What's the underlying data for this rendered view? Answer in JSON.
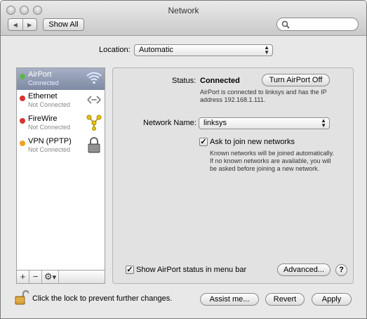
{
  "window": {
    "title": "Network"
  },
  "toolbar": {
    "back": "◀",
    "forward": "▶",
    "show_all": "Show All",
    "search_placeholder": ""
  },
  "location": {
    "label": "Location:",
    "value": "Automatic"
  },
  "services": [
    {
      "name": "AirPort",
      "status": "Connected",
      "dot": "#5ab64c",
      "icon": "wifi-icon"
    },
    {
      "name": "Ethernet",
      "status": "Not Connected",
      "dot": "#d8332c",
      "icon": "ethernet-icon"
    },
    {
      "name": "FireWire",
      "status": "Not Connected",
      "dot": "#d8332c",
      "icon": "firewire-icon"
    },
    {
      "name": "VPN (PPTP)",
      "status": "Not Connected",
      "dot": "#f0a21e",
      "icon": "vpn-lock-icon"
    }
  ],
  "sidebar_controls": {
    "add": "+",
    "remove": "−",
    "action": "⚙"
  },
  "detail": {
    "status_label": "Status:",
    "status_value": "Connected",
    "turn_off": "Turn AirPort Off",
    "status_desc_1": "AirPort is connected to linksys and has the IP",
    "status_desc_2": "address 192.168.1.111.",
    "network_name_label": "Network Name:",
    "network_name_value": "linksys",
    "ask_join_label": "Ask to join new networks",
    "ask_join_checked": true,
    "ask_desc_1": "Known networks will be joined automatically.",
    "ask_desc_2": "If no known networks are available, you will",
    "ask_desc_3": "be asked before joining a new network.",
    "show_status_label": "Show AirPort status in menu bar",
    "show_status_checked": true,
    "advanced": "Advanced...",
    "help": "?"
  },
  "footer": {
    "lock_text": "Click the lock to prevent further changes.",
    "assist": "Assist me...",
    "revert": "Revert",
    "apply": "Apply"
  }
}
